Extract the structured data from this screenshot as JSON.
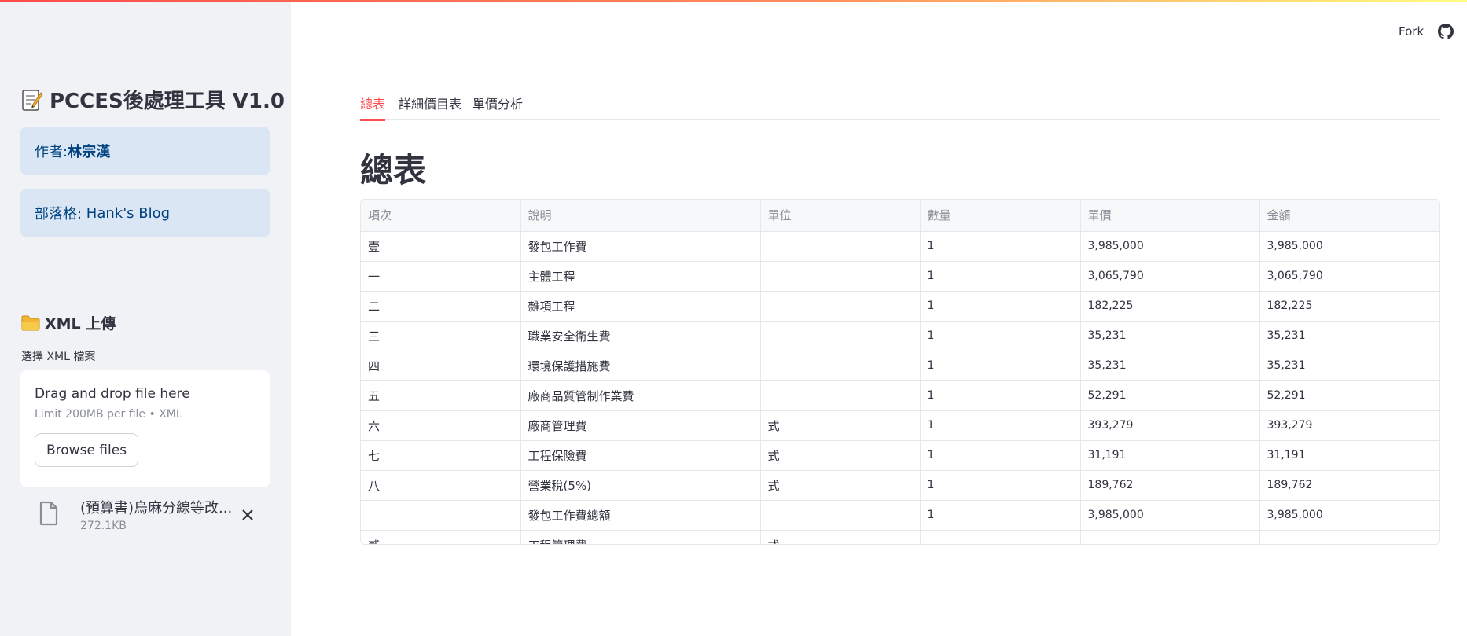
{
  "colors": {
    "accent": "#ff4b4b",
    "sidebar_bg": "#f0f2f6",
    "info_bg": "#dae6f4",
    "info_text": "#004280"
  },
  "sidebar": {
    "title": "PCCES後處理工具 V1.0",
    "title_icon": "memo-icon",
    "author_label": "作者:",
    "author_name": "林宗漢",
    "blog_label": "部落格: ",
    "blog_link": "Hank's Blog",
    "upload_header": "XML 上傳",
    "upload_icon": "folder-icon",
    "upload_label": "選擇 XML 檔案",
    "dropzone_text": "Drag and drop file here",
    "dropzone_limit": "Limit 200MB per file • XML",
    "browse_label": "Browse files",
    "file": {
      "name": "(預算書)烏麻分線等改...",
      "size": "272.1KB"
    }
  },
  "toolbar": {
    "fork_label": "Fork"
  },
  "tabs": [
    {
      "label": "總表",
      "active": true
    },
    {
      "label": "詳細價目表",
      "active": false
    },
    {
      "label": "單價分析",
      "active": false
    }
  ],
  "main": {
    "title": "總表"
  },
  "table": {
    "columns": [
      "項次",
      "說明",
      "單位",
      "數量",
      "單價",
      "金額"
    ],
    "rows": [
      [
        "壹",
        "發包工作費",
        "",
        "1",
        "3,985,000",
        "3,985,000"
      ],
      [
        "一",
        "主體工程",
        "",
        "1",
        "3,065,790",
        "3,065,790"
      ],
      [
        "二",
        "雜項工程",
        "",
        "1",
        "182,225",
        "182,225"
      ],
      [
        "三",
        "職業安全衛生費",
        "",
        "1",
        "35,231",
        "35,231"
      ],
      [
        "四",
        "環境保護措施費",
        "",
        "1",
        "35,231",
        "35,231"
      ],
      [
        "五",
        "廠商品質管制作業費",
        "",
        "1",
        "52,291",
        "52,291"
      ],
      [
        "六",
        "廠商管理費",
        "式",
        "1",
        "393,279",
        "393,279"
      ],
      [
        "七",
        "工程保險費",
        "式",
        "1",
        "31,191",
        "31,191"
      ],
      [
        "八",
        "營業稅(5%)",
        "式",
        "1",
        "189,762",
        "189,762"
      ],
      [
        "",
        "發包工作費總額",
        "",
        "1",
        "3,985,000",
        "3,985,000"
      ],
      [
        "貳",
        "工程管理費",
        "式",
        "",
        "",
        ""
      ]
    ]
  }
}
